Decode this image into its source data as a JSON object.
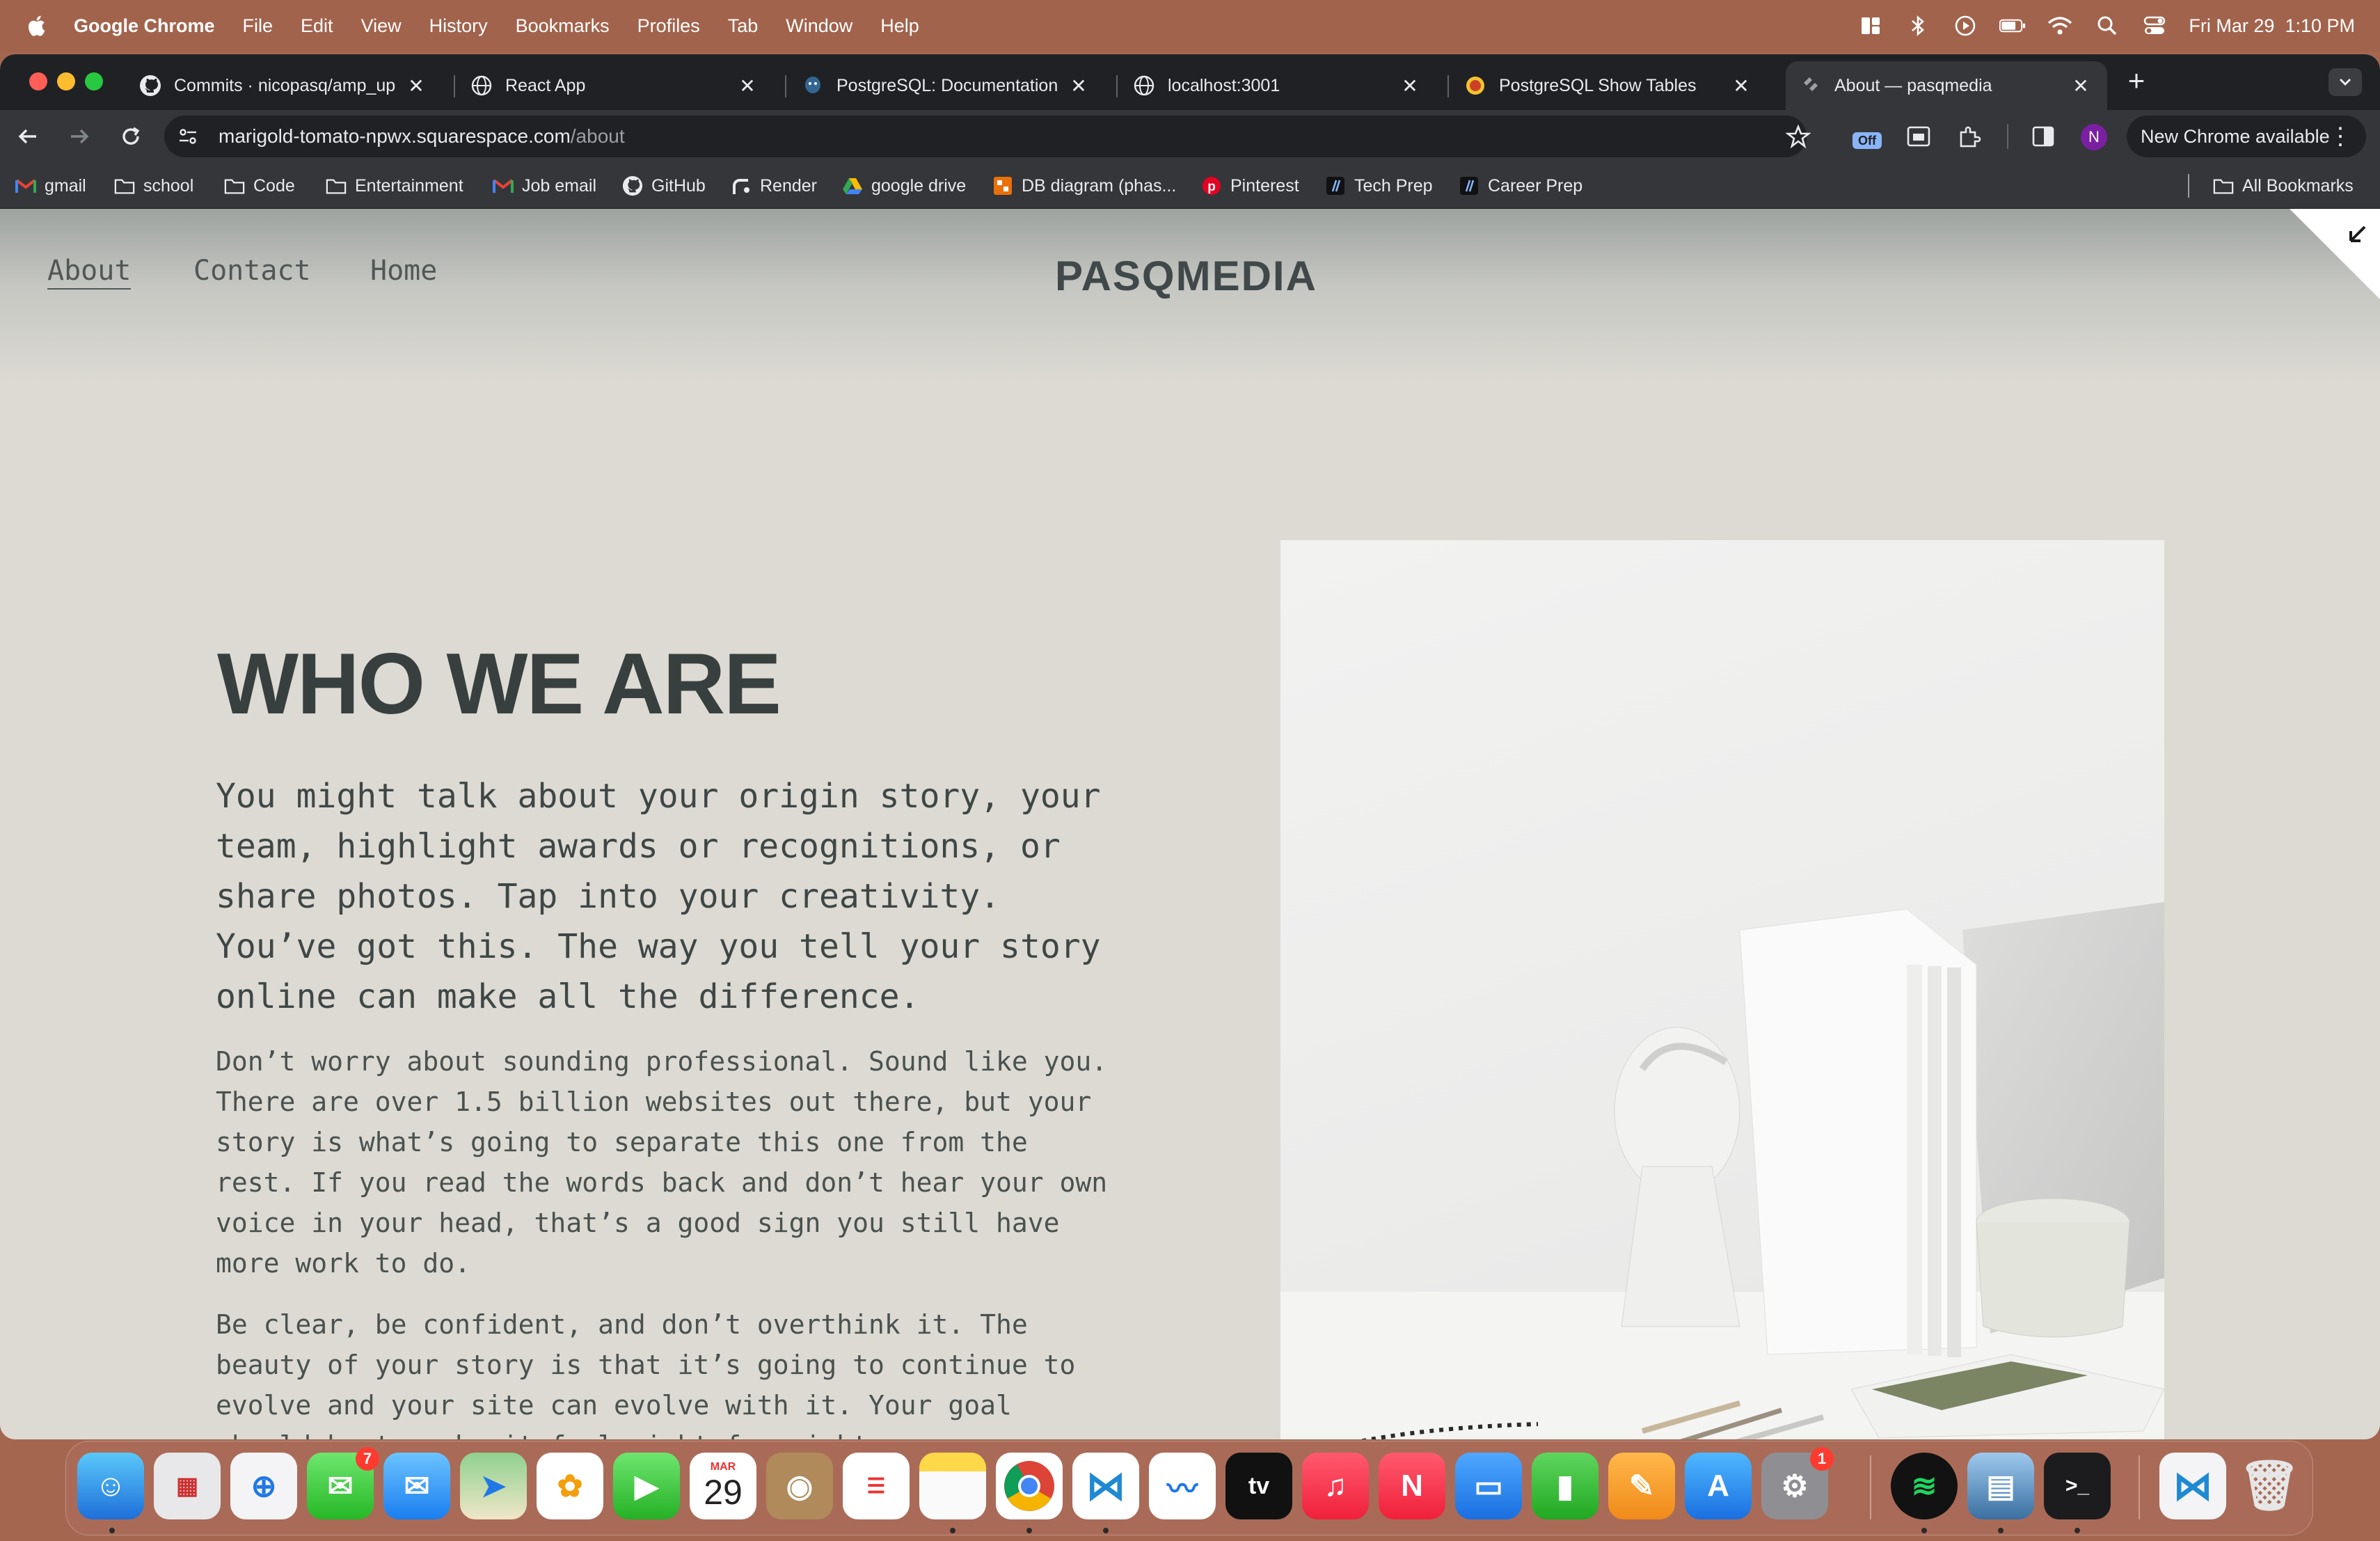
{
  "menubar": {
    "app_name": "Google Chrome",
    "items": [
      "File",
      "Edit",
      "View",
      "History",
      "Bookmarks",
      "Profiles",
      "Tab",
      "Window",
      "Help"
    ],
    "clock": "Fri Mar 29  1:10 PM"
  },
  "tabs": [
    {
      "title": "Commits · nicopasq/amp_up",
      "icon": "github-icon"
    },
    {
      "title": "React App",
      "icon": "globe-icon"
    },
    {
      "title": "PostgreSQL: Documentation",
      "icon": "postgres-icon"
    },
    {
      "title": "localhost:3001",
      "icon": "globe-icon"
    },
    {
      "title": "PostgreSQL Show Tables",
      "icon": "postgres-icon"
    },
    {
      "title": "About — pasqmedia",
      "icon": "squarespace-icon",
      "active": true
    }
  ],
  "toolbar": {
    "url_host": "marigold-tomato-npwx.squarespace.com",
    "url_path": "/about",
    "extension_badge": "Off",
    "profile_initial": "N",
    "update_button": "New Chrome available"
  },
  "bookmarks": [
    {
      "label": "gmail",
      "icon": "gmail-icon"
    },
    {
      "label": "school",
      "icon": "folder-icon"
    },
    {
      "label": "Code",
      "icon": "folder-icon"
    },
    {
      "label": "Entertainment",
      "icon": "folder-icon"
    },
    {
      "label": "Job email",
      "icon": "gmail-icon"
    },
    {
      "label": "GitHub",
      "icon": "github-icon"
    },
    {
      "label": "Render",
      "icon": "render-icon"
    },
    {
      "label": "google drive",
      "icon": "drive-icon"
    },
    {
      "label": "DB diagram (phas...",
      "icon": "dbdiagram-icon"
    },
    {
      "label": "Pinterest",
      "icon": "pinterest-icon"
    },
    {
      "label": "Tech Prep",
      "icon": "slash-icon"
    },
    {
      "label": "Career Prep",
      "icon": "slash-icon"
    }
  ],
  "all_bookmarks": "All Bookmarks",
  "site": {
    "nav": [
      "About",
      "Contact",
      "Home"
    ],
    "title": "PASQMEDIA",
    "heading": "WHO WE ARE",
    "lead": "You might talk about your origin story, your team, highlight awards or recognitions, or share photos. Tap into your creativity. You’ve got this. The way you tell your story online can make all the difference.",
    "para1": "Don’t worry about sounding professional. Sound like you. There are over 1.5 billion websites out there, but your story is what’s going to separate this one from the rest. If you read the words back and don’t hear your own voice in your head, that’s a good sign you still have more work to do.",
    "para2": "Be clear, be confident, and don’t overthink it. The beauty of your story is that it’s going to continue to evolve and your site can evolve with it. Your goal should be to make it feel right for right now."
  },
  "dock": {
    "messages_badge": "7",
    "calendar_month": "MAR",
    "calendar_day": "29",
    "settings_badge": "1"
  },
  "colors": {
    "page_bg": "#dcdad3",
    "heading": "#38403f",
    "chrome_dark": "#202124",
    "menubar": "#a2634c"
  }
}
